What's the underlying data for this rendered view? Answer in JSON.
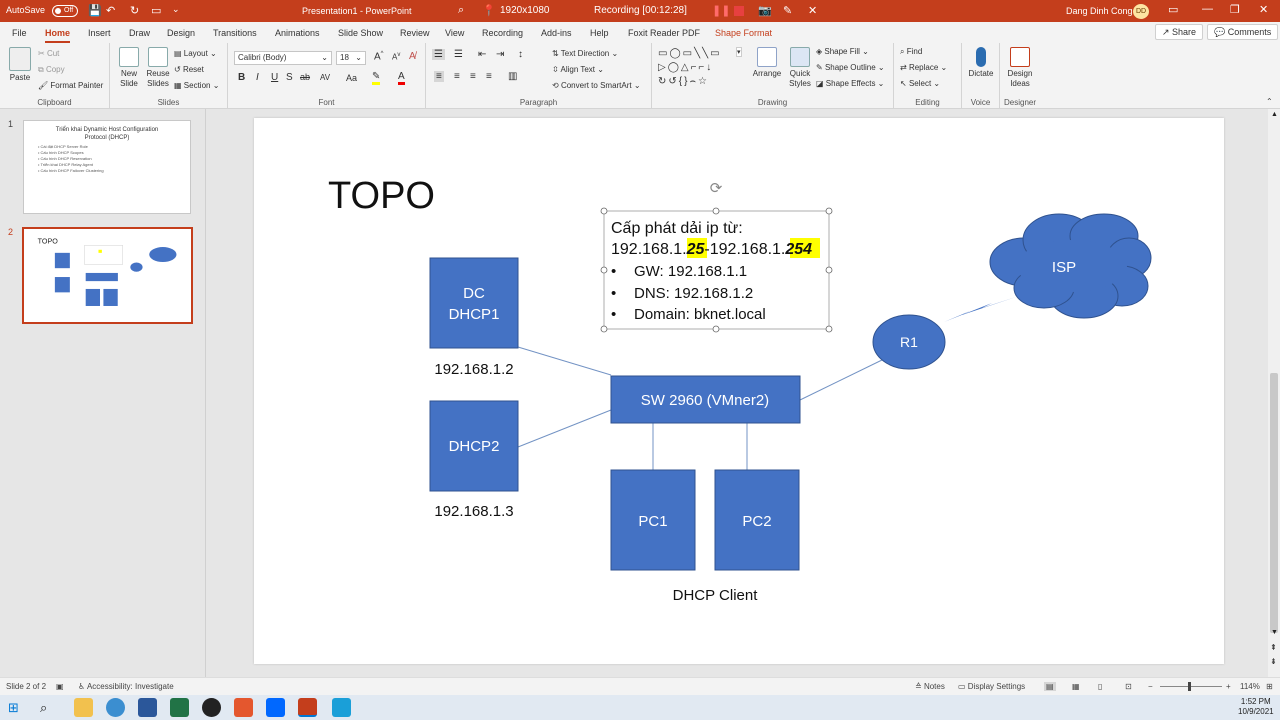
{
  "titlebar": {
    "autosave_label": "AutoSave",
    "autosave_state": "Off",
    "doc_title": "Presentation1  -  PowerPoint",
    "recorder_resolution": "1920x1080",
    "recorder_status": "Recording [00:12:28]",
    "user_name": "Dang Dinh Cong",
    "user_initials": "DD"
  },
  "tabs": {
    "items": [
      "File",
      "Home",
      "Insert",
      "Draw",
      "Design",
      "Transitions",
      "Animations",
      "Slide Show",
      "Review",
      "View",
      "Recording",
      "Add-ins",
      "Help",
      "Foxit Reader PDF",
      "Shape Format"
    ],
    "active": "Home",
    "share_label": "Share",
    "comments_label": "Comments"
  },
  "ribbon": {
    "clipboard": {
      "label": "Clipboard",
      "paste": "Paste",
      "cut": "Cut",
      "copy": "Copy",
      "format_painter": "Format Painter"
    },
    "slides": {
      "label": "Slides",
      "new_slide_1": "New",
      "new_slide_2": "Slide",
      "reuse_1": "Reuse",
      "reuse_2": "Slides",
      "layout": "Layout",
      "reset": "Reset",
      "section": "Section"
    },
    "font": {
      "label": "Font",
      "font_name": "Calibri (Body)",
      "font_size": "18",
      "bold": "B",
      "italic": "I",
      "underline": "U",
      "strike": "S",
      "shadow": "ab",
      "spacing": "AV",
      "case": "Aa",
      "clear": "A"
    },
    "paragraph": {
      "label": "Paragraph",
      "text_direction": "Text Direction",
      "align_text": "Align Text",
      "convert_smartart": "Convert to SmartArt"
    },
    "drawing": {
      "label": "Drawing",
      "arrange": "Arrange",
      "quick_styles_1": "Quick",
      "quick_styles_2": "Styles",
      "shape_fill": "Shape Fill",
      "shape_outline": "Shape Outline",
      "shape_effects": "Shape Effects"
    },
    "editing": {
      "label": "Editing",
      "find": "Find",
      "replace": "Replace",
      "select": "Select"
    },
    "voice": {
      "label": "Voice",
      "dictate": "Dictate"
    },
    "designer": {
      "label": "Designer",
      "design_ideas_1": "Design",
      "design_ideas_2": "Ideas"
    }
  },
  "slides_panel": {
    "slide1": {
      "number": "1",
      "title": "Triển khai Dynamic Host Configuration Protocol (DHCP)",
      "bullets": [
        "Cài đặt DHCP Server Role",
        "Cấu hình DHCP Scopes",
        "Cấu hình DHCP Reservation",
        "Triển khai DHCP Relay Agent",
        "Cấu hình DHCP Failover Clustering"
      ]
    },
    "slide2": {
      "number": "2",
      "title": "TOPO"
    }
  },
  "slide": {
    "title": "TOPO",
    "info_box": {
      "heading": "Cấp phát dải ip từ:",
      "range_prefix": "192.168.1.",
      "range_start": "25",
      "range_mid": "-192.168.1.",
      "range_end": "254",
      "bullets": [
        "GW: 192.168.1.1",
        "DNS: 192.168.1.2",
        "Domain: bknet.local"
      ]
    },
    "nodes": {
      "dc_line1": "DC",
      "dc_line2": "DHCP1",
      "dc_ip": "192.168.1.2",
      "dhcp2": "DHCP2",
      "dhcp2_ip": "192.168.1.3",
      "switch": "SW 2960 (VMner2)",
      "pc1": "PC1",
      "pc2": "PC2",
      "clients_caption": "DHCP Client",
      "router": "R1",
      "isp": "ISP"
    },
    "colors": {
      "shape_fill": "#4472c4",
      "shape_border": "#2f528f",
      "highlight": "#ffff00",
      "accent": "#c43e1c"
    }
  },
  "statusbar": {
    "slide_count": "Slide 2 of 2",
    "accessibility": "Accessibility: Investigate",
    "notes": "Notes",
    "display_settings": "Display Settings",
    "zoom": "114%"
  },
  "taskbar": {
    "time": "1:52 PM",
    "date": "10/9/2021"
  }
}
